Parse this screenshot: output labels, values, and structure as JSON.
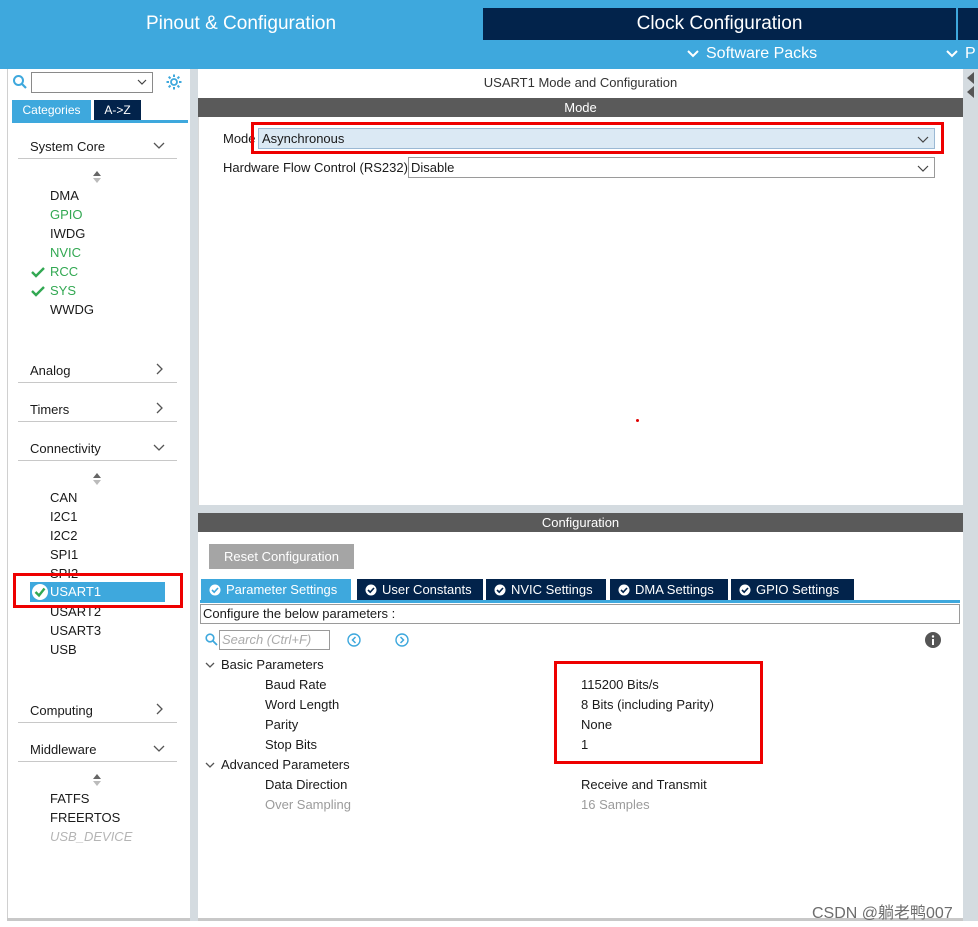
{
  "header": {
    "tab_pinout": "Pinout & Configuration",
    "tab_clock": "Clock Configuration",
    "software_packs": "Software Packs",
    "edge_label": "P"
  },
  "sidebar": {
    "search_value": "",
    "tab_categories": "Categories",
    "tab_az": "A->Z",
    "system_core": {
      "label": "System Core",
      "items": [
        "DMA",
        "GPIO",
        "IWDG",
        "NVIC",
        "RCC",
        "SYS",
        "WWDG"
      ]
    },
    "analog": "Analog",
    "timers": "Timers",
    "connectivity": {
      "label": "Connectivity",
      "items": [
        "CAN",
        "I2C1",
        "I2C2",
        "SPI1",
        "SPI2",
        "USART1",
        "USART2",
        "USART3",
        "USB"
      ]
    },
    "computing": "Computing",
    "middleware": {
      "label": "Middleware",
      "items": [
        "FATFS",
        "FREERTOS",
        "USB_DEVICE"
      ]
    }
  },
  "main": {
    "title": "USART1 Mode and Configuration",
    "mode_header": "Mode",
    "mode_label": "Mode",
    "mode_value": "Asynchronous",
    "hw_flow_label": "Hardware Flow Control (RS232)",
    "hw_flow_value": "Disable",
    "config_header": "Configuration",
    "reset_button": "Reset Configuration",
    "tabs": [
      "Parameter Settings",
      "User Constants",
      "NVIC Settings",
      "DMA Settings",
      "GPIO Settings"
    ],
    "configure_text": "Configure the below parameters :",
    "search_placeholder": "Search (Ctrl+F)",
    "groups": {
      "basic": "Basic Parameters",
      "advanced": "Advanced Parameters"
    },
    "params": [
      {
        "name": "Baud Rate",
        "value": "115200 Bits/s"
      },
      {
        "name": "Word Length",
        "value": "8 Bits (including Parity)"
      },
      {
        "name": "Parity",
        "value": "None"
      },
      {
        "name": "Stop Bits",
        "value": "1"
      },
      {
        "name": "Data Direction",
        "value": "Receive and Transmit"
      },
      {
        "name": "Over Sampling",
        "value": "16 Samples"
      }
    ]
  },
  "watermark": "CSDN @躺老鸭007",
  "colors": {
    "accent": "#3ea8dd",
    "dark_navy": "#02234b",
    "enabled_green": "#32a852",
    "highlight_red": "#ee0000"
  }
}
